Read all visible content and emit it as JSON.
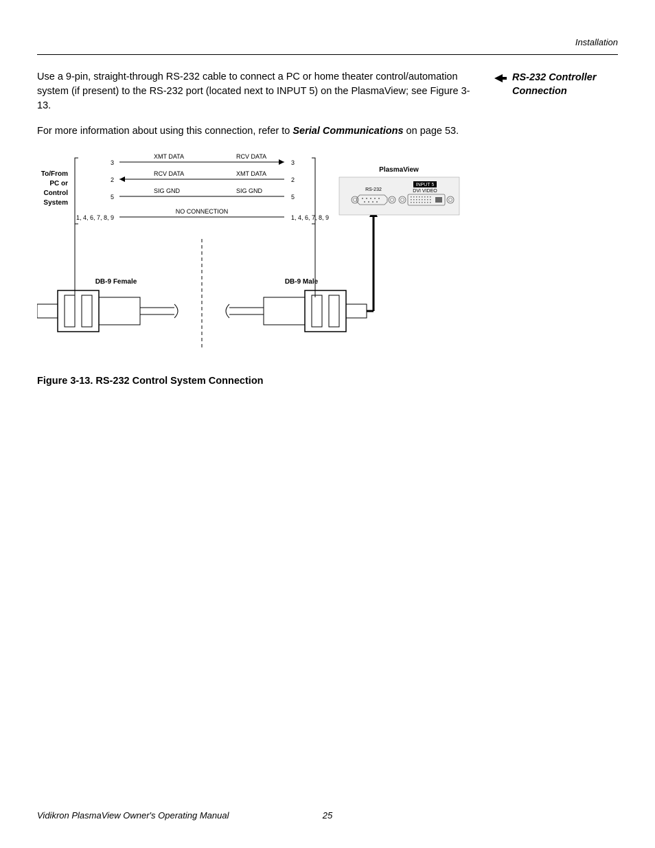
{
  "header": {
    "section": "Installation"
  },
  "side": {
    "title_line1": "RS-232 Controller",
    "title_line2": "Connection"
  },
  "body": {
    "p1": "Use a 9-pin, straight-through RS-232 cable to connect a PC or home theater control/automation system (if present) to the RS-232 port (located next to INPUT 5) on the PlasmaView; see Figure 3-13.",
    "p2a": "For more information about using this connection, refer to ",
    "p2b": "Serial Communications",
    "p2c": " on page 53."
  },
  "diagram": {
    "left_label_l1": "To/From",
    "left_label_l2": "PC or",
    "left_label_l3": "Control",
    "left_label_l4": "System",
    "pin3": "3",
    "pin2": "2",
    "pin5": "5",
    "pins_rest": "1, 4, 6, 7, 8, 9",
    "xmt": "XMT DATA",
    "rcv": "RCV DATA",
    "sig": "SIG GND",
    "noconn": "NO CONNECTION",
    "db9f": "DB-9 Female",
    "db9m": "DB-9 Male",
    "pv_title": "PlasmaView",
    "rs232_lbl": "RS-232",
    "input5_lbl": "INPUT 5",
    "dvivideo_lbl": "DVI VIDEO"
  },
  "caption": "Figure 3-13. RS-232 Control System Connection",
  "footer": {
    "left": "Vidikron PlasmaView Owner's Operating Manual",
    "page": "25"
  }
}
